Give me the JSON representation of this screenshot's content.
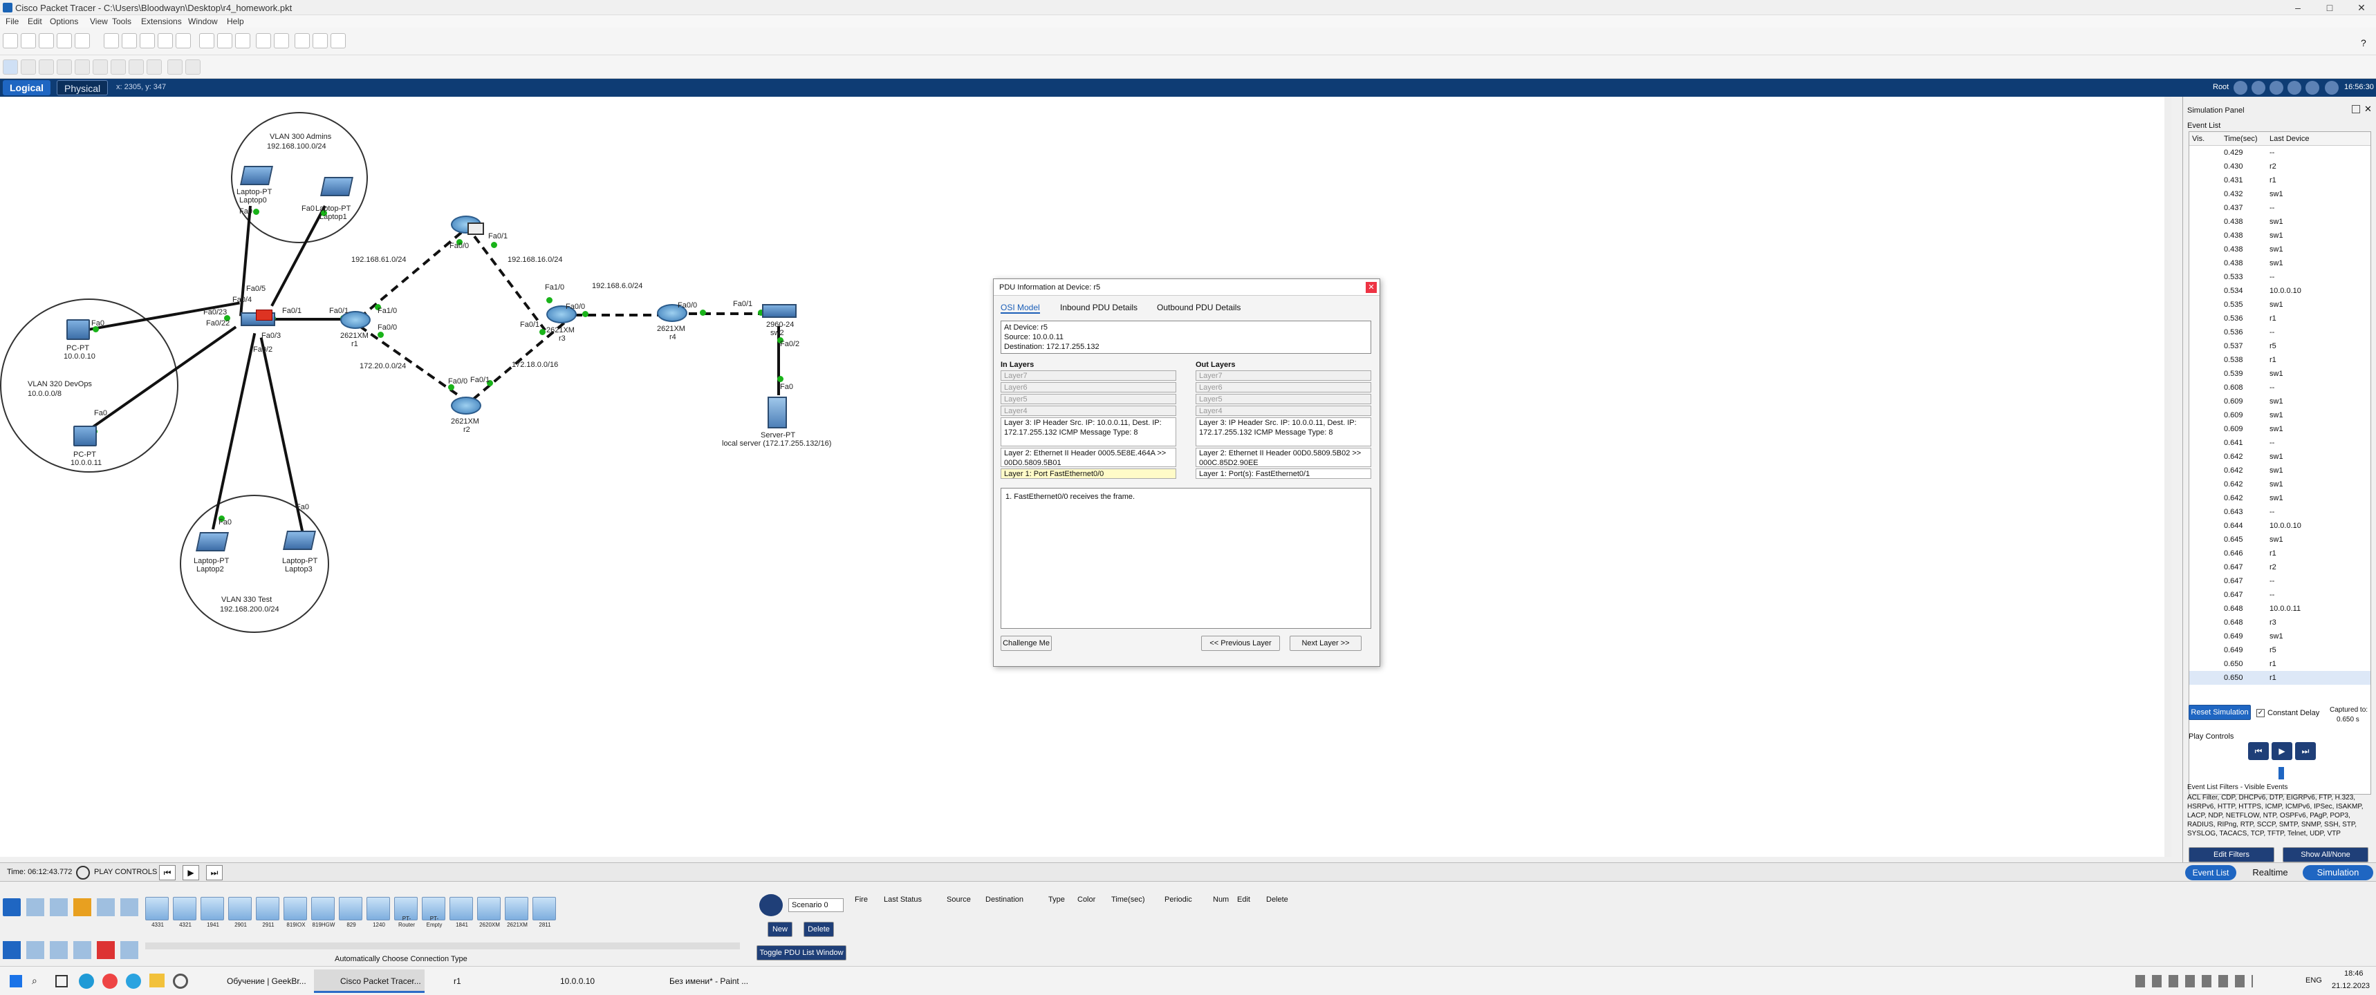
{
  "window": {
    "title": "Cisco Packet Tracer - C:\\Users\\Bloodwayn\\Desktop\\r4_homework.pkt"
  },
  "menu": [
    "File",
    "Edit",
    "Options",
    "View",
    "Tools",
    "Extensions",
    "Window",
    "Help"
  ],
  "nav": {
    "logical": "Logical",
    "physical": "Physical",
    "coords": "x: 2305, y: 347",
    "root": "Root",
    "clock": "16:56:30"
  },
  "topology": {
    "vlan300": {
      "name": "VLAN 300 Admins",
      "net": "192.168.100.0/24"
    },
    "vlan320": {
      "name": "VLAN 320 DevOps",
      "net": "10.0.0.0/8"
    },
    "vlan330": {
      "name": "VLAN 330 Test",
      "net": "192.168.200.0/24"
    },
    "devices": {
      "laptop0": "Laptop-PT",
      "laptop0b": "Laptop0",
      "laptop1": "Laptop-PT",
      "laptop1b": "Laptop1",
      "laptop2": "Laptop-PT",
      "laptop2b": "Laptop2",
      "laptop3": "Laptop-PT",
      "laptop3b": "Laptop3",
      "pc1": "PC-PT",
      "pc1ip": "10.0.0.10",
      "pc2": "PC-PT",
      "pc2ip": "10.0.0.11",
      "r1": "2621XM",
      "r1b": "r1",
      "r2": "2621XM",
      "r2b": "r2",
      "r3": "2621XM",
      "r3b": "r3",
      "r4": "2621XM",
      "r4b": "r4",
      "sw2": "2960-24",
      "sw2b": "sw2",
      "server": "Server-PT",
      "serverb": "local server (172.17.255.132/16)"
    },
    "ports": {
      "fa0_l0": "Fa0",
      "fa0_l1": "Fa0",
      "fa0_pc1": "Fa0",
      "fa0_pc2": "Fa0",
      "fa0_l2": "Fa0",
      "fa0_l3": "Fa0",
      "sw_fa05": "Fa0/5",
      "sw_fa04": "Fa0/4",
      "sw_fa023": "Fa0/23",
      "sw_fa022": "Fa0/22",
      "sw_fa03": "Fa0/3",
      "sw_fa02": "Fa0/2",
      "sw_fa01": "Fa0/1",
      "r1_fa10": "Fa1/0",
      "r1_fa01": "Fa0/1",
      "r1_fa00": "Fa0/0",
      "r5_fa00": "Fa0/0",
      "r5_fa01": "Fa0/1",
      "r3_fa10": "Fa1/0",
      "r3_fa01": "Fa0/1",
      "r3_fa00": "Fa0/0",
      "r4_fa00": "Fa0/0",
      "r4_fa01": "Fa0/1",
      "r2_fa00": "Fa0/0",
      "r2_fa01": "Fa0/1",
      "sw2_fa01": "Fa0/1",
      "sw2_fa02": "Fa0/2",
      "srv_fa0": "Fa0"
    },
    "nets": {
      "n1": "192.168.61.0/24",
      "n2": "192.168.16.0/24",
      "n3": "192.168.6.0/24",
      "n4": "172.20.0.0/24",
      "n5": "172.18.0.0/16"
    }
  },
  "pdu": {
    "title": "PDU Information at Device: r5",
    "tabs": [
      "OSI Model",
      "Inbound PDU Details",
      "Outbound PDU Details"
    ],
    "info": [
      "At Device: r5",
      "Source: 10.0.0.11",
      "Destination: 172.17.255.132"
    ],
    "in_title": "In Layers",
    "out_title": "Out Layers",
    "in_layers": [
      "Layer7",
      "Layer6",
      "Layer5",
      "Layer4",
      "Layer 3: IP Header Src. IP: 10.0.0.11, Dest. IP: 172.17.255.132 ICMP Message Type: 8",
      "Layer 2: Ethernet II Header 0005.5E8E.464A >> 00D0.5809.5B01",
      "Layer 1: Port FastEthernet0/0"
    ],
    "out_layers": [
      "Layer7",
      "Layer6",
      "Layer5",
      "Layer4",
      "Layer 3: IP Header Src. IP: 10.0.0.11, Dest. IP: 172.17.255.132 ICMP Message Type: 8",
      "Layer 2: Ethernet II Header 00D0.5809.5B02 >> 000C.85D2.90EE",
      "Layer 1: Port(s): FastEthernet0/1"
    ],
    "description": "1. FastEthernet0/0 receives the frame.",
    "challenge": "Challenge Me",
    "prev": "<< Previous Layer",
    "next": "Next Layer >>"
  },
  "sim_panel": {
    "title": "Simulation Panel",
    "event_list": "Event List",
    "cols": [
      "Vis.",
      "Time(sec)",
      "Last Device"
    ],
    "events": [
      {
        "t": "0.429",
        "d": "--"
      },
      {
        "t": "0.430",
        "d": "r2"
      },
      {
        "t": "0.431",
        "d": "r1"
      },
      {
        "t": "0.432",
        "d": "sw1"
      },
      {
        "t": "0.437",
        "d": "--"
      },
      {
        "t": "0.438",
        "d": "sw1"
      },
      {
        "t": "0.438",
        "d": "sw1"
      },
      {
        "t": "0.438",
        "d": "sw1"
      },
      {
        "t": "0.438",
        "d": "sw1"
      },
      {
        "t": "0.533",
        "d": "--"
      },
      {
        "t": "0.534",
        "d": "10.0.0.10"
      },
      {
        "t": "0.535",
        "d": "sw1"
      },
      {
        "t": "0.536",
        "d": "r1"
      },
      {
        "t": "0.536",
        "d": "--"
      },
      {
        "t": "0.537",
        "d": "r5"
      },
      {
        "t": "0.538",
        "d": "r1"
      },
      {
        "t": "0.539",
        "d": "sw1"
      },
      {
        "t": "0.608",
        "d": "--"
      },
      {
        "t": "0.609",
        "d": "sw1"
      },
      {
        "t": "0.609",
        "d": "sw1"
      },
      {
        "t": "0.609",
        "d": "sw1"
      },
      {
        "t": "0.641",
        "d": "--"
      },
      {
        "t": "0.642",
        "d": "sw1"
      },
      {
        "t": "0.642",
        "d": "sw1"
      },
      {
        "t": "0.642",
        "d": "sw1"
      },
      {
        "t": "0.642",
        "d": "sw1"
      },
      {
        "t": "0.643",
        "d": "--"
      },
      {
        "t": "0.644",
        "d": "10.0.0.10"
      },
      {
        "t": "0.645",
        "d": "sw1"
      },
      {
        "t": "0.646",
        "d": "r1"
      },
      {
        "t": "0.647",
        "d": "r2"
      },
      {
        "t": "0.647",
        "d": "--"
      },
      {
        "t": "0.647",
        "d": "--"
      },
      {
        "t": "0.648",
        "d": "10.0.0.11"
      },
      {
        "t": "0.648",
        "d": "r3"
      },
      {
        "t": "0.649",
        "d": "sw1"
      },
      {
        "t": "0.649",
        "d": "r5"
      },
      {
        "t": "0.650",
        "d": "r1"
      },
      {
        "t": "0.650",
        "d": "r1"
      }
    ],
    "reset": "Reset Simulation",
    "constant_delay": "Constant Delay",
    "captured": "Captured to:",
    "captured_val": "0.650 s",
    "play_controls": "Play Controls",
    "filters_title": "Event List Filters - Visible Events",
    "filters_text": "ACL Filter, CDP, DHCPv6, DTP, EIGRPv6, FTP, H.323, HSRPv6, HTTP, HTTPS, ICMP, ICMPv6, IPSec, ISAKMP, LACP, NDP, NETFLOW, NTP, OSPFv6, PAgP, POP3, RADIUS, RIPng, RTP, SCCP, SMTP, SNMP, SSH, STP, SYSLOG, TACACS, TCP, TFTP, Telnet, UDP, VTP",
    "edit_filters": "Edit Filters",
    "show_all": "Show All/None"
  },
  "status": {
    "time": "Time: 06:12:43.772",
    "play": "PLAY CONTROLS",
    "event_list": "Event List",
    "realtime": "Realtime",
    "simulation": "Simulation"
  },
  "bottom": {
    "models": [
      "4331",
      "4321",
      "1941",
      "2901",
      "2911",
      "819IOX",
      "819HGW",
      "829",
      "1240",
      "PT-Router",
      "PT-Empty",
      "1841",
      "2620XM",
      "2621XM",
      "2811"
    ],
    "conn_type": "Automatically Choose Connection Type",
    "scenario": "Scenario 0",
    "new": "New",
    "delete": "Delete",
    "toggle": "Toggle PDU List Window",
    "pdu_cols": [
      "Fire",
      "Last Status",
      "Source",
      "Destination",
      "Type",
      "Color",
      "Time(sec)",
      "Periodic",
      "Num",
      "Edit",
      "Delete"
    ]
  },
  "taskbar": {
    "apps": [
      "Обучение | GeekBr...",
      "Cisco Packet Tracer...",
      "r1",
      "10.0.0.10",
      "Без имени* - Paint ..."
    ],
    "lang": "ENG",
    "time": "18:46",
    "date": "21.12.2023"
  }
}
